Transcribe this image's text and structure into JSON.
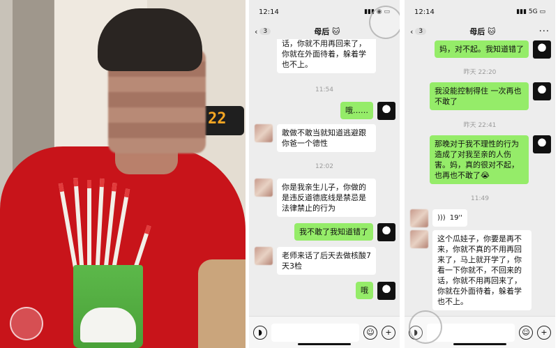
{
  "photo": {
    "thermostat_value": "22"
  },
  "left_phone": {
    "time": "12:14",
    "back_count": "3",
    "title": "母后",
    "messages": [
      {
        "dir": "in",
        "text": "话，你就不用再回来了，你就在外面待着，躲着学也不上。"
      },
      {
        "time": "11:54"
      },
      {
        "dir": "out",
        "text": "哦……"
      },
      {
        "dir": "in",
        "text": "敢做不敢当就知道逃避跟你爸一个德性"
      },
      {
        "time": "12:02"
      },
      {
        "dir": "in",
        "text": "你是我亲生儿子，你做的是违反道德底线是禁忌是法律禁止的行为"
      },
      {
        "dir": "out",
        "text": "我不敢了我知道错了"
      },
      {
        "dir": "in",
        "text": "老师来话了后天去做核酸7天3检"
      },
      {
        "dir": "out",
        "text": "哦"
      }
    ]
  },
  "right_phone": {
    "time": "12:14",
    "network": "5G",
    "back_count": "3",
    "title": "母后",
    "messages": [
      {
        "dir": "out",
        "text": "妈，对不起。我知道错了"
      },
      {
        "time": "昨天 22:20"
      },
      {
        "dir": "out",
        "text": "我没能控制得住 一次再也不敢了"
      },
      {
        "time": "昨天 22:41"
      },
      {
        "dir": "out",
        "text": "那晚对于我不理性的行为造成了对我至亲的人伤害。妈，真的很对不起，也再也不敢了😭"
      },
      {
        "time": "11:49"
      },
      {
        "dir": "in",
        "voice": "19''"
      },
      {
        "dir": "in",
        "text": "这个瓜娃子，你要是再不来，你就不真的不用再回来了，马上就开学了，你看一下你就不，不回来的话，你就不用再回来了，你就在外面待着，躲着学也不上。"
      }
    ]
  },
  "colors": {
    "outgoing_bubble": "#95ec69",
    "incoming_bubble": "#ffffff",
    "chat_bg": "#ededed"
  }
}
